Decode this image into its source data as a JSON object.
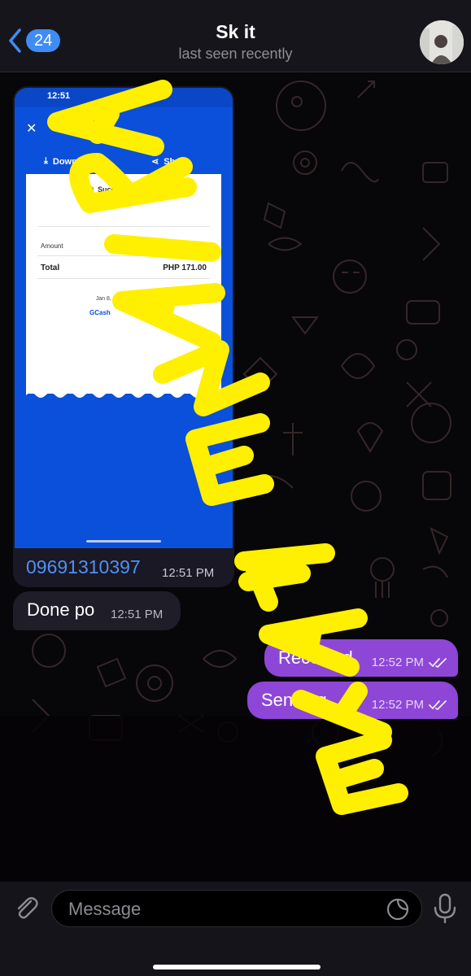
{
  "header": {
    "back_count": "24",
    "title": "Sk it",
    "subtitle": "last seen recently"
  },
  "photo_message": {
    "screenshot": {
      "status_time": "12:51",
      "download_label": "Download",
      "share_label": "Share",
      "receipt_status": "Successfully Sent",
      "amount_label": "Amount",
      "amount_value": "PHP 171.00",
      "total_label": "Total",
      "total_value": "PHP 171.00",
      "date": "Jan 8, 2023 12:51 PM",
      "brand": "GCash"
    },
    "caption": "09691310397",
    "time": "12:51 PM"
  },
  "messages": [
    {
      "direction": "in",
      "text": "Done po",
      "time": "12:51 PM"
    },
    {
      "direction": "out",
      "text": "Received",
      "time": "12:52 PM",
      "status": "read"
    },
    {
      "direction": "out",
      "text": "Sending",
      "time": "12:52 PM",
      "status": "read"
    }
  ],
  "overlay": {
    "text": "ARIANE FAYE",
    "color": "#FFEF00"
  },
  "input": {
    "placeholder": "Message"
  },
  "icons": {
    "back": "chevron-left-icon",
    "attach": "paperclip-icon",
    "sticker": "sticker-icon",
    "mic": "microphone-icon"
  },
  "colors": {
    "accent": "#3F8DF4",
    "outgoing_bubble": "#8E46D7",
    "incoming_bubble": "#1F1D27",
    "gcash_blue": "#0B50DA"
  }
}
